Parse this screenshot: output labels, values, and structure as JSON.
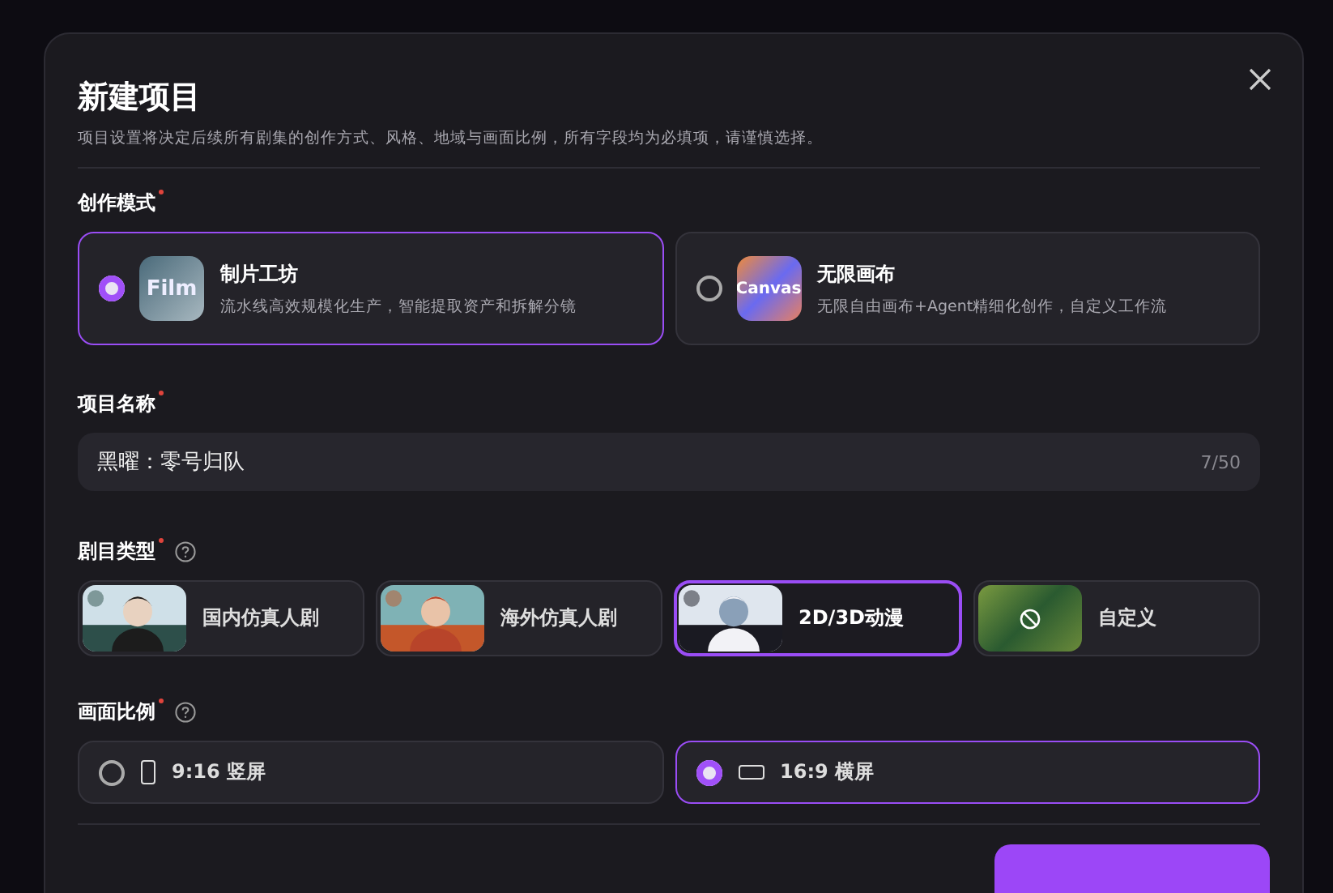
{
  "dialog": {
    "title": "新建项目",
    "subtitle": "项目设置将决定后续所有剧集的创作方式、风格、地域与画面比例，所有字段均为必填项，请谨慎选择。"
  },
  "mode": {
    "label": "创作模式",
    "required": true,
    "options": [
      {
        "title": "制片工坊",
        "desc": "流水线高效规模化生产，智能提取资产和拆解分镜",
        "icon_text": "Film",
        "kind": "film",
        "selected": true
      },
      {
        "title": "无限画布",
        "desc": "无限自由画布+Agent精细化创作，自定义工作流",
        "icon_text": "Canvas",
        "kind": "canvas",
        "selected": false
      }
    ]
  },
  "name": {
    "label": "项目名称",
    "required": true,
    "value": "黑曜：零号归队",
    "counter": "7/50"
  },
  "genre": {
    "label": "剧目类型",
    "required": true,
    "help": true,
    "options": [
      {
        "label": "国内仿真人剧",
        "kind": "picture",
        "selected": false
      },
      {
        "label": "海外仿真人剧",
        "kind": "picture",
        "selected": false
      },
      {
        "label": "2D/3D动漫",
        "kind": "picture",
        "selected": true
      },
      {
        "label": "自定义",
        "kind": "custom",
        "selected": false
      }
    ]
  },
  "ratio": {
    "label": "画面比例",
    "required": true,
    "help": true,
    "options": [
      {
        "label": "9:16 竖屏",
        "kind": "portrait",
        "selected": false
      },
      {
        "label": "16:9 横屏",
        "kind": "landscape",
        "selected": true
      }
    ]
  },
  "confirm_button": {
    "kind": "primary"
  }
}
